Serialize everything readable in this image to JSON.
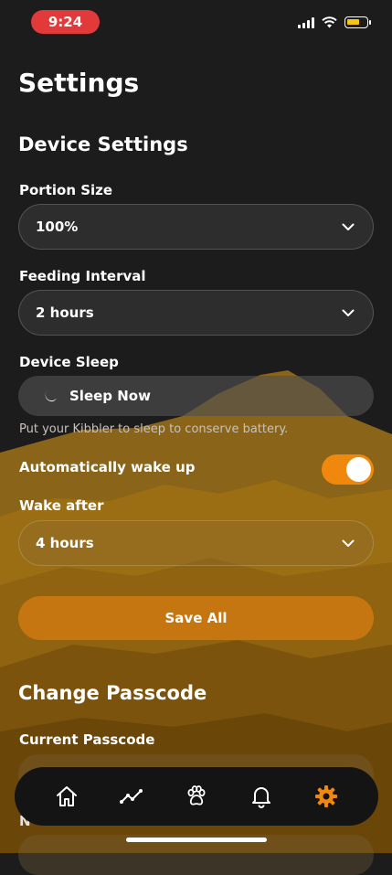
{
  "status_bar": {
    "time": "9:24"
  },
  "page": {
    "title": "Settings"
  },
  "device_settings": {
    "heading": "Device Settings",
    "portion_size": {
      "label": "Portion Size",
      "value": "100%"
    },
    "feeding_interval": {
      "label": "Feeding Interval",
      "value": "2 hours"
    },
    "device_sleep": {
      "label": "Device Sleep",
      "button_label": "Sleep Now",
      "hint": "Put your Kibbler to sleep to conserve battery."
    },
    "auto_wake": {
      "label": "Automatically wake up",
      "enabled": true
    },
    "wake_after": {
      "label": "Wake after",
      "value": "4 hours"
    },
    "save_label": "Save All"
  },
  "change_passcode": {
    "heading": "Change Passcode",
    "current_label": "Current Passcode",
    "new_label_partial": "N"
  },
  "tab_bar": {
    "items": [
      {
        "icon": "home-icon",
        "active": false
      },
      {
        "icon": "stats-icon",
        "active": false
      },
      {
        "icon": "paw-icon",
        "active": false
      },
      {
        "icon": "bell-icon",
        "active": false
      },
      {
        "icon": "gear-icon",
        "active": true
      }
    ]
  },
  "colors": {
    "accent": "#f0880e",
    "time_pill": "#e23a3a",
    "background": "#1c1c1c"
  }
}
